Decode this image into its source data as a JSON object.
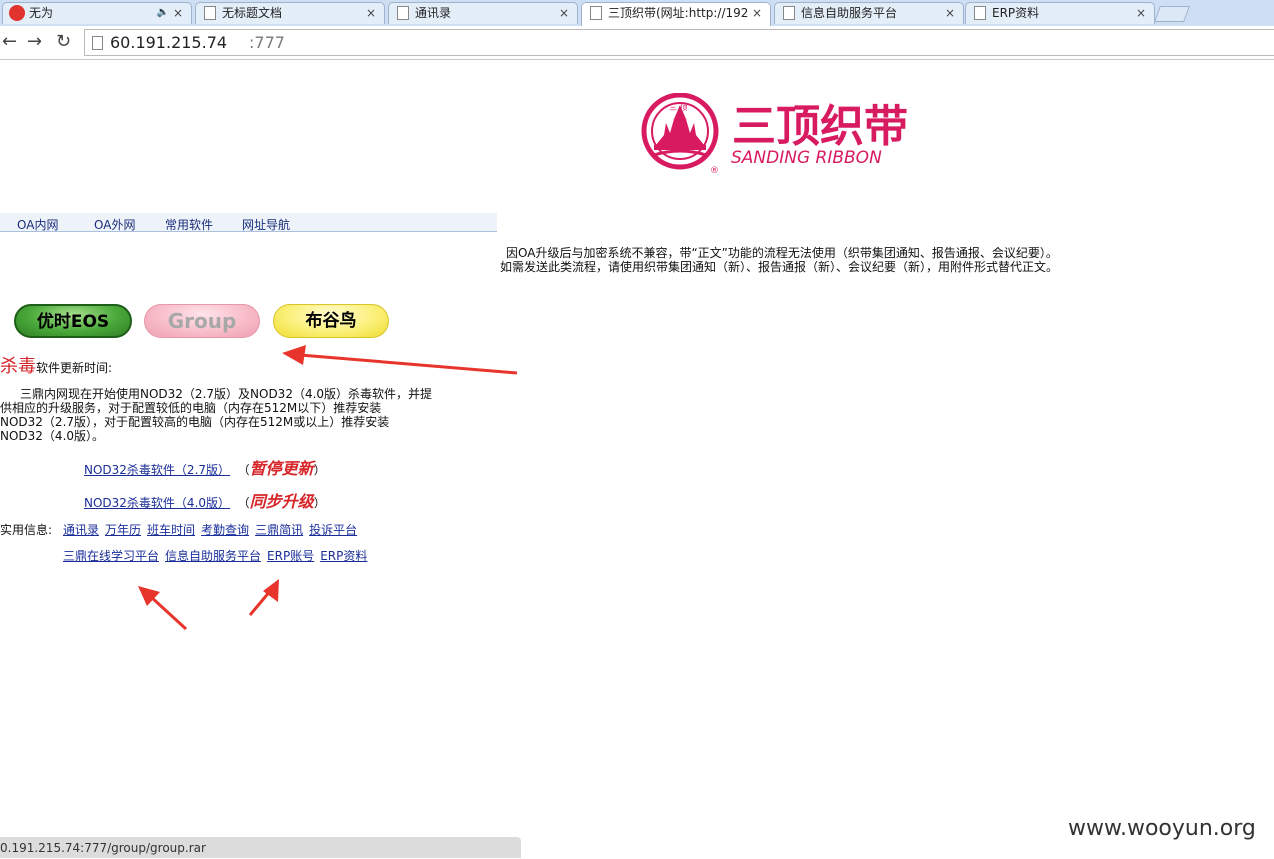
{
  "browser": {
    "tabs": [
      {
        "title": "无为",
        "icon": "weibo-icon",
        "audio": "🔈"
      },
      {
        "title": "无标题文档",
        "icon": "page-icon"
      },
      {
        "title": "通讯录",
        "icon": "page-icon"
      },
      {
        "title": "三顶织带(网址:http://192",
        "icon": "page-icon",
        "active": true
      },
      {
        "title": "信息自助服务平台",
        "icon": "page-icon"
      },
      {
        "title": "ERP资料",
        "icon": "page-icon"
      }
    ],
    "tab_close": "×",
    "nav": {
      "back": "←",
      "forward": "→",
      "reload": "↻"
    },
    "url_host": "60.191.215.74",
    "url_port": ":777"
  },
  "logo": {
    "cn": "三顶织带",
    "en": "SANDING RIBBON",
    "seal": "三 顶",
    "registered": "®",
    "color": "#d81b60"
  },
  "topnav": [
    "OA内网",
    "OA外网",
    "常用软件",
    "网址导航"
  ],
  "notice": [
    "因OA升级后与加密系统不兼容，带“正文”功能的流程无法使用（织带集团通知、报告通报、会议纪要）。",
    "如需发送此类流程，请使用织带集团通知（新）、报告通报（新）、会议纪要（新），用附件形式替代正文。"
  ],
  "buttons": {
    "eos": "优时EOS",
    "group": "Group",
    "bugu": "布谷鸟"
  },
  "antivirus": {
    "title_red": "杀毒",
    "title_rest": "软件更新时间:",
    "desc": [
      "三鼎内网现在开始使用NOD32（2.7版）及NOD32（4.0版）杀毒软件，并提",
      "供相应的升级服务，对于配置较低的电脑（内存在512M以下）推荐安装",
      "NOD32（2.7版），对于配置较高的电脑（内存在512M或以上）推荐安装",
      "NOD32（4.0版）。"
    ],
    "downloads": [
      {
        "link": "NOD32杀毒软件（2.7版）",
        "status": "暂停更新"
      },
      {
        "link": "NOD32杀毒软件（4.0版）",
        "status": "同步升级"
      }
    ]
  },
  "info": {
    "label": "实用信息:",
    "row1": [
      "通讯录",
      "万年历",
      "班车时间",
      "考勤查询",
      "三鼎简讯",
      "投诉平台"
    ],
    "row2": [
      "三鼎在线学习平台",
      "信息自助服务平台",
      "ERP账号",
      "ERP资料"
    ]
  },
  "status_bar": "0.191.215.74:777/group/group.rar",
  "watermark": "www.wooyun.org"
}
